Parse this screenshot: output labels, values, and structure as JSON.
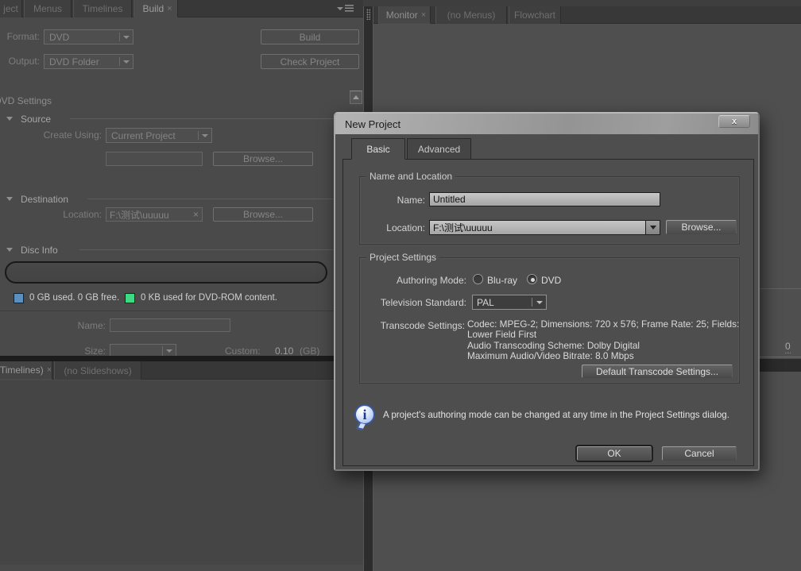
{
  "ui": {
    "close_glyph": "×"
  },
  "left_panel": {
    "tabs": [
      {
        "label": "ject"
      },
      {
        "label": "Menus"
      },
      {
        "label": "Timelines"
      },
      {
        "label": "Build",
        "active": true
      }
    ],
    "format_label": "Format:",
    "format_value": "DVD",
    "output_label": "Output:",
    "output_value": "DVD Folder",
    "build_button": "Build",
    "check_project_button": "Check Project",
    "settings_title": "DVD Settings",
    "source": {
      "header": "Source",
      "create_using_label": "Create Using:",
      "create_using_value": "Current Project",
      "path_value": "",
      "browse_button": "Browse..."
    },
    "destination": {
      "header": "Destination",
      "location_label": "Location:",
      "location_value": "F:\\测试\\uuuuu",
      "browse_button": "Browse..."
    },
    "disc_info": {
      "header": "Disc Info",
      "used_legend": "0 GB used.  0 GB free.",
      "used_color": "#5b8fc0",
      "dvdrom_legend": "0 KB used for DVD-ROM content.",
      "dvdrom_color": "#3fd986",
      "name_label": "Name:",
      "name_value": "",
      "size_label": "Size:",
      "size_value": "",
      "custom_label": "Custom:",
      "custom_value": "0.10",
      "custom_unit": "(GB)"
    },
    "bottom_tabs": [
      {
        "label": "Timelines)",
        "active": true
      },
      {
        "label": "(no Slideshows)"
      }
    ]
  },
  "right_panel": {
    "tabs": [
      {
        "label": "Monitor",
        "active": true
      },
      {
        "label": "(no Menus)"
      },
      {
        "label": "Flowchart"
      }
    ],
    "timecode_fragment": "0"
  },
  "dialog": {
    "title": "New Project",
    "close_label": "x",
    "tabs": [
      {
        "label": "Basic",
        "active": true
      },
      {
        "label": "Advanced"
      }
    ],
    "name_location": {
      "title": "Name and Location",
      "name_label": "Name:",
      "name_value": "Untitled",
      "location_label": "Location:",
      "location_value": "F:\\测试\\uuuuu",
      "browse_button": "Browse..."
    },
    "project_settings": {
      "title": "Project Settings",
      "authoring_mode_label": "Authoring Mode:",
      "bluray_label": "Blu-ray",
      "dvd_label": "DVD",
      "selected_mode": "DVD",
      "tv_standard_label": "Television Standard:",
      "tv_standard_value": "PAL",
      "transcode_label": "Transcode Settings:",
      "transcode_lines": [
        "Codec: MPEG-2; Dimensions: 720 x 576; Frame Rate: 25; Fields:",
        "Lower Field First",
        "Audio Transcoding Scheme: Dolby Digital",
        "Maximum Audio/Video Bitrate: 8.0 Mbps"
      ],
      "default_transcode_button": "Default Transcode Settings..."
    },
    "info_text": "A project's authoring mode can be changed at any time in the Project Settings dialog.",
    "ok_button": "OK",
    "cancel_button": "Cancel"
  }
}
